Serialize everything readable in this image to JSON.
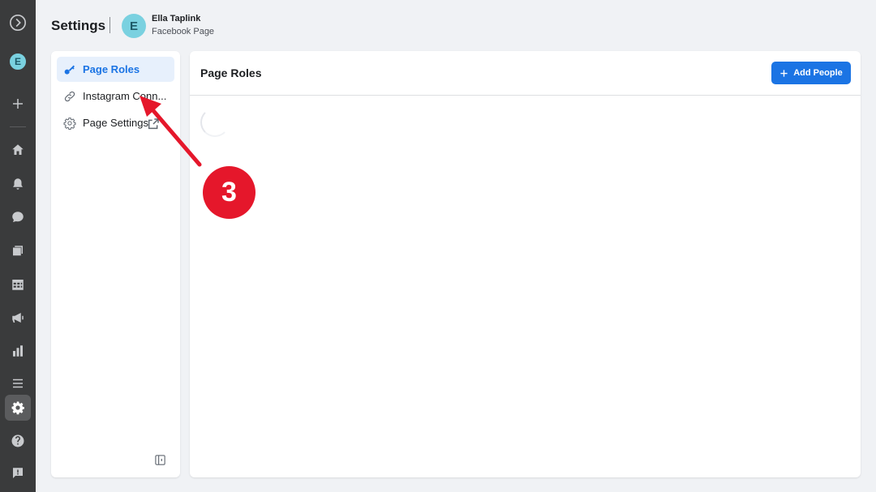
{
  "header": {
    "title": "Settings",
    "avatar_initial": "E",
    "page_name": "Ella Taplink",
    "page_type": "Facebook Page"
  },
  "rail": {
    "avatar_initial": "E",
    "icons": [
      "logo-icon",
      "add-icon",
      "home-icon",
      "bell-icon",
      "chat-icon",
      "pages-icon",
      "calendar-icon",
      "megaphone-icon",
      "insights-icon",
      "menu-icon",
      "settings-icon",
      "help-icon",
      "report-icon"
    ],
    "active": "settings-icon"
  },
  "sidebar": {
    "items": [
      {
        "label": "Page Roles",
        "icon": "key-icon",
        "selected": true
      },
      {
        "label": "Instagram Conn...",
        "icon": "link-icon",
        "selected": false
      },
      {
        "label": "Page Settings",
        "icon": "gear-icon",
        "selected": false,
        "external": true
      }
    ]
  },
  "main": {
    "title": "Page Roles",
    "add_button_label": "Add People"
  },
  "annotation": {
    "step_number": "3"
  },
  "colors": {
    "accent": "#1b74e4",
    "rail": "#3a3b3c",
    "annotation_red": "#e5172b",
    "avatar": "#7ad1e0"
  }
}
